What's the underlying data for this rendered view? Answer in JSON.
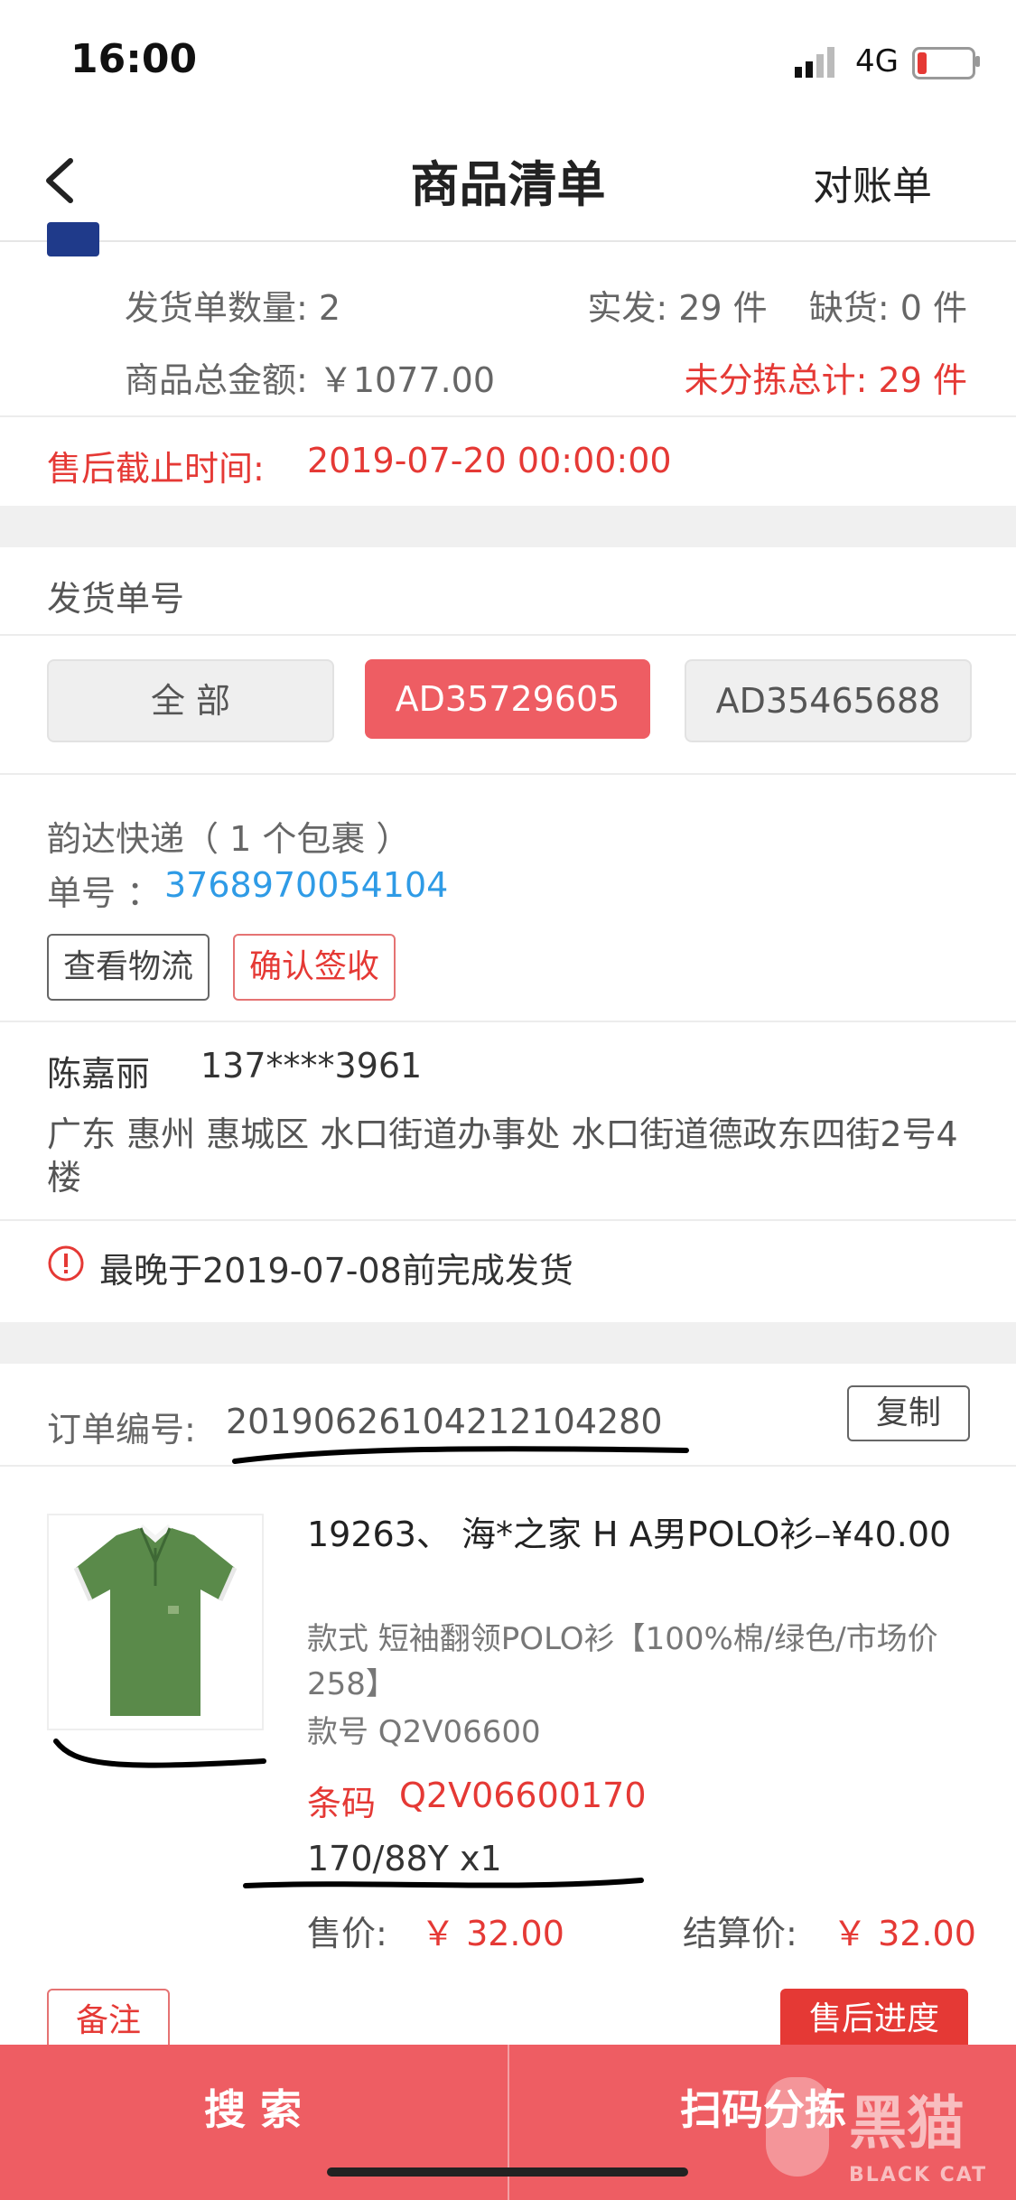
{
  "status_bar": {
    "time": "16:00",
    "network": "4G"
  },
  "nav": {
    "title": "商品清单",
    "right": "对账单"
  },
  "summary": {
    "shipments_label": "发货单数量: 2",
    "shipped_label": "实发: 29 件",
    "shortage_label": "缺货: 0 件",
    "total_amount_label": "商品总金额: ￥1077.00",
    "unsorted_label": "未分拣总计: 29 件",
    "after_sale_label": "售后截止时间:",
    "after_sale_value": "2019-07-20 00:00:00"
  },
  "shipment": {
    "section_title": "发货单号",
    "tabs": [
      "全 部",
      "AD35729605",
      "AD35465688"
    ],
    "carrier": "韵达快递（ 1 个包裹 ）",
    "tracking_label": "单号 ：",
    "tracking_number": "3768970054104",
    "btn_logistics": "查看物流",
    "btn_confirm": "确认签收",
    "recipient_name": "陈嘉丽",
    "recipient_phone": "137****3961",
    "address": "广东 惠州 惠城区 水口街道办事处 水口街道德政东四街2号4楼",
    "deadline": "最晚于2019-07-08前完成发货"
  },
  "order": {
    "order_no_label": "订单编号:",
    "order_no": "20190626104212104280",
    "copy_btn": "复制",
    "product_title": "19263、 海*之家 H A男POLO衫–¥40.00",
    "style": "款式 短袖翻领POLO衫【100%棉/绿色/市场价258】",
    "style_no": "款号 Q2V06600",
    "barcode_label": "条码",
    "barcode": "Q2V06600170",
    "size_qty": "170/88Y x1",
    "price_label": "售价:",
    "price": "￥ 32.00",
    "settle_label": "结算价:",
    "settle_price": "￥ 32.00",
    "note_btn": "备注",
    "after_sale_btn": "售后进度"
  },
  "bottom": {
    "search": "搜 索",
    "scan": "扫码分拣"
  },
  "watermark": {
    "text": "黑猫",
    "sub": "BLACK CAT"
  },
  "colors": {
    "accent": "#ee5d63",
    "red": "#e53935",
    "link": "#2f9be6",
    "product": "#5a8a4a"
  }
}
